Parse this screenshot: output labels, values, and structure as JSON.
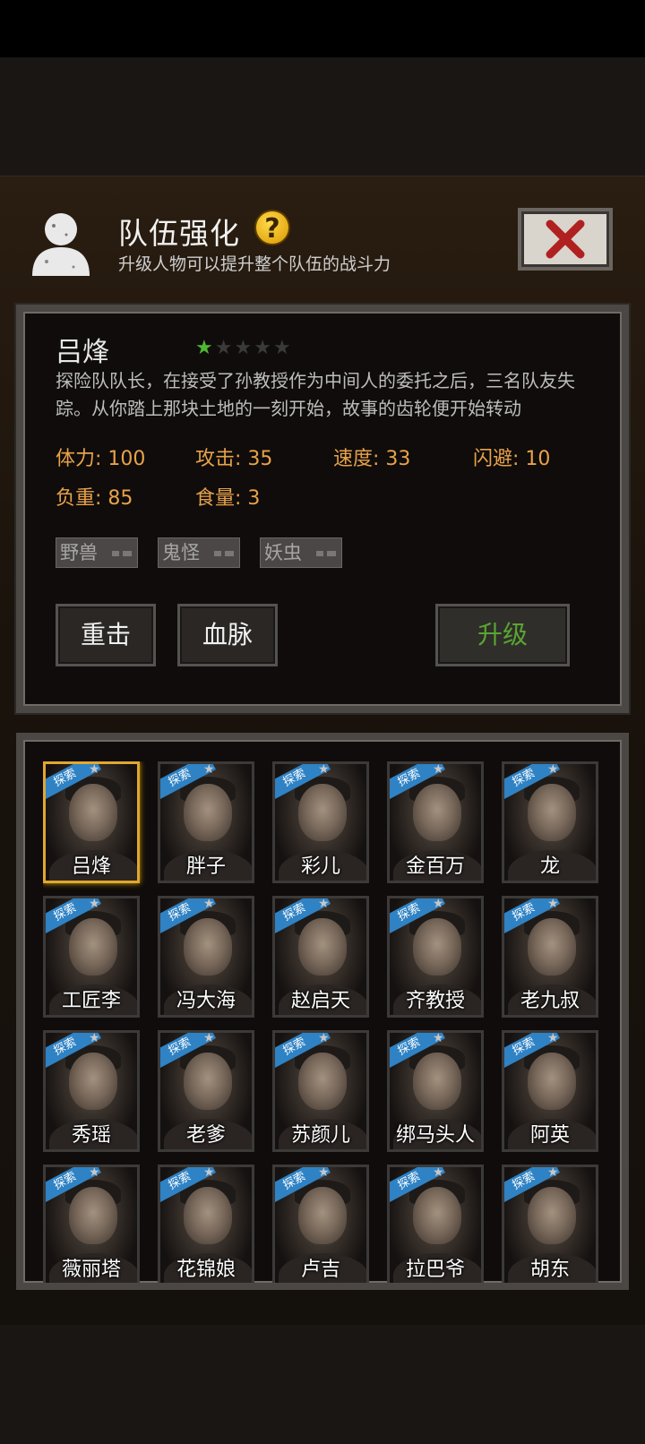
{
  "header": {
    "title": "队伍强化",
    "help_glyph": "?",
    "subtitle": "升级人物可以提升整个队伍的战斗力"
  },
  "selected": {
    "name": "吕烽",
    "stars_total": 5,
    "stars_filled": 1,
    "description": "探险队队长，在接受了孙教授作为中间人的委托之后，三名队友失踪。从你踏上那块土地的一刻开始，故事的齿轮便开始转动",
    "stats": {
      "stamina": "体力: 100",
      "attack": "攻击: 35",
      "speed": "速度: 33",
      "dodge": "闪避: 10",
      "load": "负重: 85",
      "food": "食量: 3"
    },
    "tags": [
      "野兽",
      "鬼怪",
      "妖虫"
    ],
    "buttons": {
      "skill1": "重击",
      "skill2": "血脉",
      "upgrade": "升级"
    }
  },
  "colors": {
    "accent_gold": "#e0a830",
    "stat_orange": "#e8a24a",
    "upgrade_green": "#5aa532",
    "ribbon_blue": "#2f82c4"
  },
  "ribbon_label": "探索",
  "characters": [
    {
      "name": "吕烽"
    },
    {
      "name": "胖子"
    },
    {
      "name": "彩儿"
    },
    {
      "name": "金百万"
    },
    {
      "name": "龙"
    },
    {
      "name": "工匠李"
    },
    {
      "name": "冯大海"
    },
    {
      "name": "赵启天"
    },
    {
      "name": "齐教授"
    },
    {
      "name": "老九叔"
    },
    {
      "name": "秀瑶"
    },
    {
      "name": "老爹"
    },
    {
      "name": "苏颜儿"
    },
    {
      "name": "绑马头人"
    },
    {
      "name": "阿英"
    },
    {
      "name": "薇丽塔"
    },
    {
      "name": "花锦娘"
    },
    {
      "name": "卢吉"
    },
    {
      "name": "拉巴爷"
    },
    {
      "name": "胡东"
    }
  ]
}
